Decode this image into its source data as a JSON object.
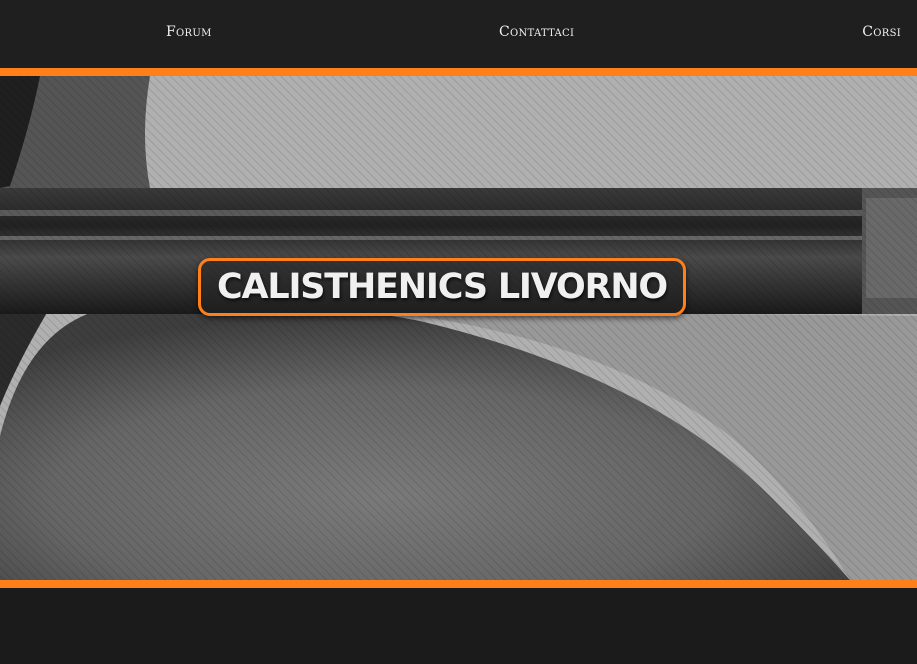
{
  "nav": {
    "items": [
      {
        "label": "Forum"
      },
      {
        "label": "Contattaci"
      },
      {
        "label": "Corsi"
      }
    ]
  },
  "hero": {
    "title": "CALISTHENICS LIVORNO",
    "image": "black-and-white photo of a barbell resting on a person's back and shoulder"
  },
  "colors": {
    "accent": "#ff7f1a",
    "navbar": "#1f1f1f",
    "text": "#f2f2f2"
  }
}
